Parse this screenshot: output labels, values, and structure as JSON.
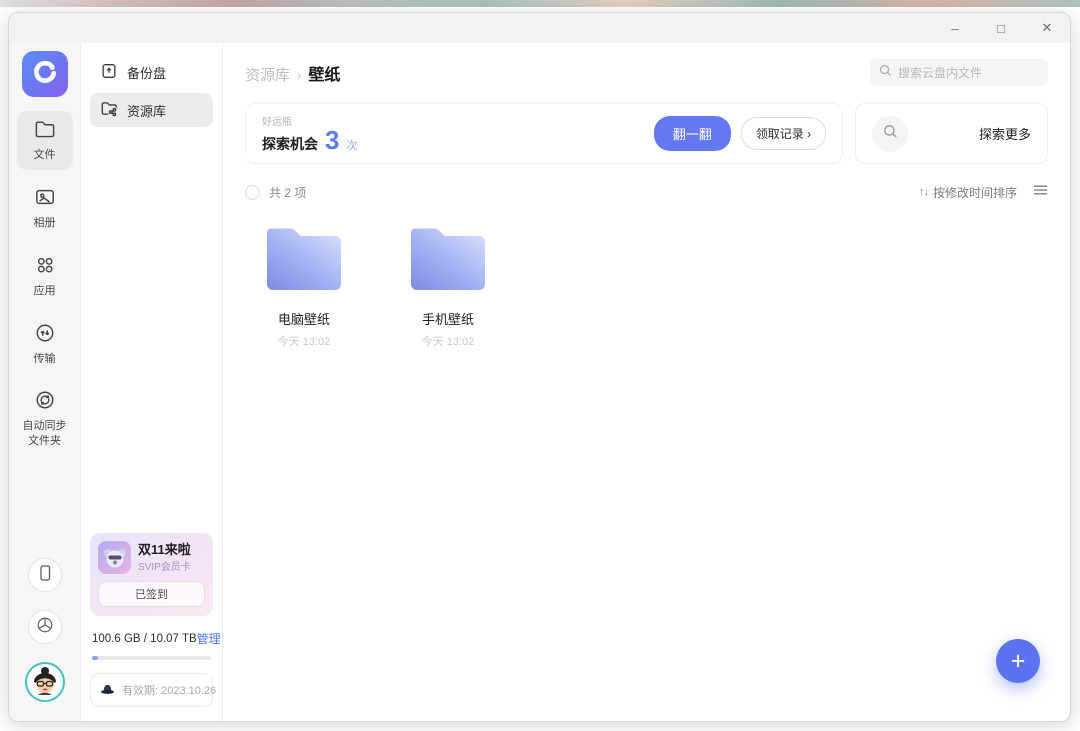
{
  "colors": {
    "accent_blue": "#5b73ef",
    "count_blue": "#5b7bf5",
    "manage_blue": "#4a7af2",
    "folder_dark": "#858be6",
    "folder_light": "#d0dcfc",
    "rail_bg": "#f6f6f7",
    "titlebar_bg": "#f2f2f1",
    "promo_gradient_from": "#e9e5fb",
    "promo_gradient_to": "#fbe9f3"
  },
  "titlebar": {
    "minimize": "–",
    "maximize": "□",
    "close": "✕"
  },
  "nav_rail": {
    "items": [
      {
        "label": "文件",
        "icon": "folder-icon",
        "active": true
      },
      {
        "label": "相册",
        "icon": "photo-icon",
        "active": false
      },
      {
        "label": "应用",
        "icon": "apps-grid-icon",
        "active": false
      },
      {
        "label": "传输",
        "icon": "transfer-icon",
        "active": false
      },
      {
        "label": "自动同步文件夹",
        "icon": "sync-icon",
        "active": false
      }
    ]
  },
  "sidebar": {
    "items": [
      {
        "label": "备份盘",
        "icon": "backup-drive-icon",
        "active": false
      },
      {
        "label": "资源库",
        "icon": "library-folder-icon",
        "active": true
      }
    ],
    "promo": {
      "title": "双11来啦",
      "subtitle": "SVIP会员卡",
      "button": "已签到"
    },
    "storage": {
      "text": "100.6 GB / 10.07 TB",
      "manage": "管理",
      "percent": 5
    },
    "validity": {
      "label": "有效期: 2023.10.26"
    }
  },
  "main": {
    "breadcrumb": {
      "parent": "资源库",
      "separator": "›",
      "current": "壁纸"
    },
    "search": {
      "placeholder": "搜索云盘内文件"
    },
    "luck_card": {
      "tag": "好运瓶",
      "label": "探索机会",
      "count": "3",
      "unit": "次",
      "flip_button": "翻一翻",
      "record_button": "领取记录 ›"
    },
    "explore_card": {
      "more_label": "探索更多"
    },
    "list_header": {
      "count_label": "共 2 项",
      "sort_arrows": "↑↓",
      "sort_label": "按修改时间排序"
    },
    "folders": [
      {
        "name": "电脑壁纸",
        "time": "今天 13:02"
      },
      {
        "name": "手机壁纸",
        "time": "今天 13:02"
      }
    ],
    "fab": {
      "label": "+"
    }
  }
}
